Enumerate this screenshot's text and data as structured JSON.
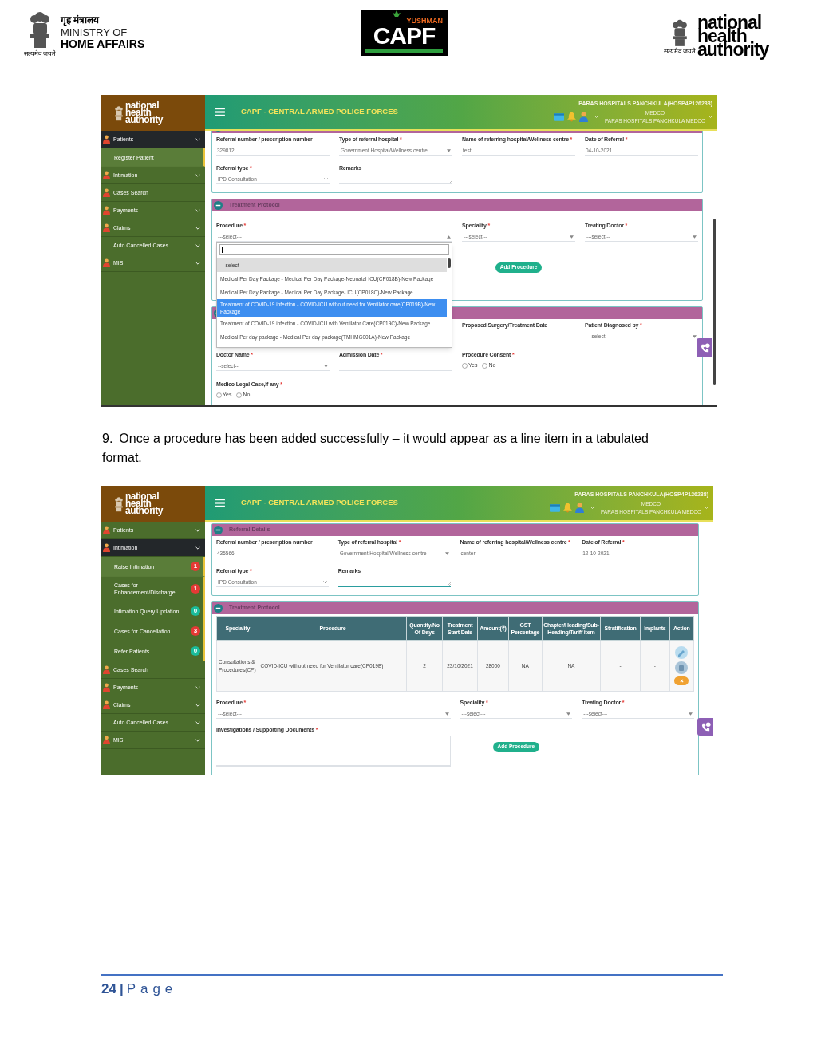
{
  "header": {
    "ministry": {
      "hindi": "गृह मंत्रालय",
      "line1": "MINISTRY OF",
      "line2": "HOME AFFAIRS",
      "motto": "सत्यमेव जयते"
    },
    "capf_logo": {
      "small": "YUSHMAN",
      "big": "CAPF"
    },
    "nha_logo": {
      "wordmark": "national health authority",
      "motto": "सत्यमेव जयते"
    }
  },
  "screens": [
    {
      "scrolled": true,
      "brand": "national health authority",
      "title": "CAPF - CENTRAL ARMED POLICE FORCES",
      "hospital": "PARAS HOSPITALS PANCHKULA(HOSP4P126288)",
      "role": "MEDCO",
      "org": "PARAS HOSPITALS PANCHKULA MEDCO",
      "sidebar": [
        {
          "label": "Patients",
          "kind": "menu",
          "selected": true,
          "children": [
            {
              "label": "Register Patient",
              "selected": true
            }
          ]
        },
        {
          "label": "Intimation",
          "kind": "menu",
          "selected": false
        },
        {
          "label": "Cases Search",
          "kind": "link",
          "selected": false
        },
        {
          "label": "Payments",
          "kind": "menu",
          "selected": false
        },
        {
          "label": "Claims",
          "kind": "menu",
          "selected": false
        },
        {
          "label": "Auto Cancelled Cases",
          "kind": "plain_menu",
          "selected": false
        },
        {
          "label": "MIS",
          "kind": "menu",
          "selected": false
        }
      ],
      "sections": [
        {
          "kind": "referral",
          "rows": [
            [
              {
                "kind": "text",
                "label": "Referral number / prescription number",
                "value": "329812"
              },
              {
                "kind": "select",
                "label": "Type of referral hospital",
                "mark": "*",
                "value": "Government Hospital/Wellness centre"
              },
              {
                "kind": "text",
                "label": "Name of referring hospital/Wellness centre",
                "mark": "*",
                "value": "test"
              },
              {
                "kind": "text",
                "label": "Date of Referral",
                "mark": "*",
                "value": "04-10-2021"
              }
            ],
            [
              {
                "kind": "select_chevron",
                "label": "Referral type",
                "mark": "*",
                "value": "IPD Consultation"
              },
              {
                "kind": "textarea",
                "label": "Remarks",
                "focused": false
              }
            ]
          ]
        },
        {
          "kind": "protocol",
          "title": "Treatment Protocol",
          "rows": [
            [
              {
                "kind": "combo",
                "label": "Procedure",
                "mark": "*",
                "value": "---select---",
                "open": true,
                "options": [
                  {
                    "label": "---select---",
                    "selected": true,
                    "highlighted": false
                  },
                  {
                    "label": "Medical Per Day Package - Medical Per Day Package-Neonatal ICU(CP018B)-New Package",
                    "selected": false,
                    "highlighted": false
                  },
                  {
                    "label": "Medical Per Day Package - Medical Per Day Package- ICU(CP018C)-New Package",
                    "selected": false,
                    "highlighted": false
                  },
                  {
                    "label": "Treatment of COVID-19 infection - COVID-ICU without need for Ventilator care(CP019B)-New Package",
                    "selected": false,
                    "highlighted": true
                  },
                  {
                    "label": "Treatment of COVID-19 infection - COVID-ICU with Ventilator Care(CP019C)-New Package",
                    "selected": false,
                    "highlighted": false
                  },
                  {
                    "label": "Medical Per day package - Medical Per day package(TMHMG001A)-New Package",
                    "selected": false,
                    "highlighted": false
                  }
                ]
              },
              {
                "kind": "select",
                "label": "Speciality",
                "mark": "*",
                "value": "---select---"
              },
              {
                "kind": "select",
                "label": "Treating Doctor",
                "mark": "*",
                "value": "---select---"
              }
            ],
            [
              {
                "kind": "button",
                "label": "Add Procedure"
              }
            ]
          ]
        },
        {
          "kind": "details",
          "rows": [
            [
              "",
              "",
              {
                "kind": "text",
                "label": "Proposed Surgery/Treatment Date"
              },
              {
                "kind": "select",
                "label": "Patient Diagnosed by",
                "mark": "*",
                "value": "---select---"
              }
            ],
            [
              {
                "kind": "select",
                "label": "Doctor Name",
                "mark": "*",
                "value": "--select--"
              },
              {
                "kind": "text",
                "label": "Admission Date",
                "mark": "*"
              },
              {
                "kind": "radio",
                "label": "Procedure Consent",
                "mark": "*",
                "options": [
                  {
                    "label": "Yes",
                    "checked": false
                  },
                  {
                    "label": "No",
                    "checked": false
                  }
                ]
              }
            ],
            [
              {
                "kind": "radio",
                "label": "Medico Legal Case,If any",
                "mark": "*",
                "options": [
                  {
                    "label": "Yes",
                    "checked": false
                  },
                  {
                    "label": "No",
                    "checked": false
                  }
                ]
              }
            ]
          ]
        }
      ]
    },
    {
      "scrolled": false,
      "brand": "national health authority",
      "title": "CAPF - CENTRAL ARMED POLICE FORCES",
      "hospital": "PARAS HOSPITALS PANCHKULA(HOSP4P126288)",
      "role": "MEDCO",
      "org": "PARAS HOSPITALS PANCHKULA MEDCO",
      "sidebar": [
        {
          "label": "Patients",
          "kind": "menu",
          "selected": false
        },
        {
          "label": "Intimation",
          "kind": "menu",
          "selected": true,
          "children": [
            {
              "label": "Raise Intimation",
              "badge": "1",
              "color": "#e53935",
              "selected": true
            },
            {
              "label": "Cases for Enhancement/Discharge",
              "badge": "1",
              "color": "#e53935",
              "selected": false
            },
            {
              "label": "Intimation Query Updation",
              "badge": "0",
              "color": "#1bbc9b",
              "selected": false
            },
            {
              "label": "Cases for Cancellation",
              "badge": "3",
              "color": "#e53935",
              "selected": false
            },
            {
              "label": "Refer Patients",
              "badge": "0",
              "color": "#1bbc9b",
              "selected": false
            }
          ]
        },
        {
          "label": "Cases Search",
          "kind": "link",
          "selected": false
        },
        {
          "label": "Payments",
          "kind": "menu",
          "selected": false
        },
        {
          "label": "Claims",
          "kind": "menu",
          "selected": false
        },
        {
          "label": "Auto Cancelled Cases",
          "kind": "plain_menu",
          "selected": false
        },
        {
          "label": "MIS",
          "kind": "menu",
          "selected": false
        }
      ],
      "sections": [
        {
          "kind": "referral",
          "title": "Referral Details",
          "rows": [
            [
              {
                "kind": "text",
                "label": "Referral number / prescription number",
                "value": "435566"
              },
              {
                "kind": "select",
                "label": "Type of referral hospital",
                "mark": "*",
                "value": "Government Hospital/Wellness centre"
              },
              {
                "kind": "text",
                "label": "Name of referring hospital/Wellness centre",
                "mark": "*",
                "value": "center"
              },
              {
                "kind": "text",
                "label": "Date of Referral",
                "mark": "*",
                "value": "12-10-2021"
              }
            ],
            [
              {
                "kind": "select_chevron",
                "label": "Referral type",
                "mark": "*",
                "value": "IPD Consultation"
              },
              {
                "kind": "textarea",
                "label": "Remarks",
                "focused": true
              }
            ]
          ]
        },
        {
          "kind": "protocol",
          "title": "Treatment Protocol",
          "table": {
            "columns": [
              "Speciality",
              "Procedure",
              "Quantity/No Of Days",
              "Treatment Start Date",
              "Amount(₹)",
              "GST Percentage",
              "Chapter/Heading/Sub-Heading/Tariff item",
              "Stratification",
              "Implants",
              "Action"
            ],
            "rows": [
              [
                "Consultations & Procedures(CP)",
                "COVID-ICU without need for Ventilator care(CP019B)",
                "2",
                "23/10/2021",
                "28000",
                "NA",
                "NA",
                "-",
                "-"
              ]
            ]
          },
          "rows": [
            [
              {
                "kind": "combo",
                "label": "Procedure",
                "mark": "*",
                "value": "---select---",
                "open": false
              },
              {
                "kind": "select",
                "label": "Speciality",
                "mark": "*",
                "value": "---select---"
              },
              {
                "kind": "select",
                "label": "Treating Doctor",
                "mark": "*",
                "value": "---select---"
              }
            ],
            [
              {
                "kind": "upload",
                "label": "Investigations / Supporting Documents",
                "mark": "*"
              },
              {
                "kind": "button",
                "label": "Add Procedure"
              }
            ]
          ]
        }
      ]
    }
  ],
  "caption": {
    "number": "9.",
    "text": "Once a procedure has been added successfully – it would appear as a line item in a tabulated format."
  },
  "footer": {
    "page_number": "24",
    "separator": "|",
    "label": "Page"
  }
}
